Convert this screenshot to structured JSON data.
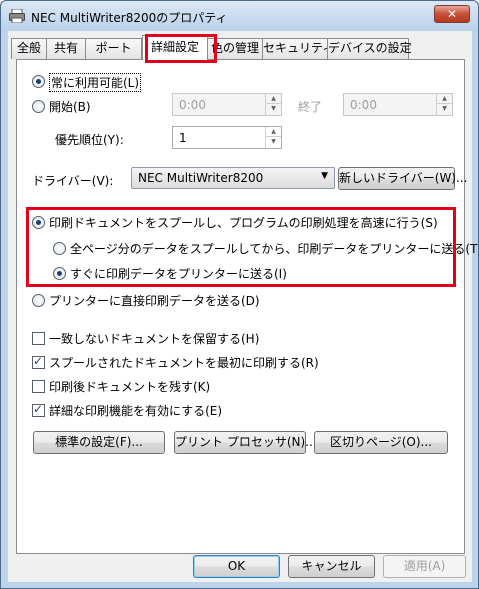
{
  "window": {
    "title": "NEC MultiWriter8200のプロパティ",
    "close_label": "✕"
  },
  "tabs": [
    {
      "label": "全般"
    },
    {
      "label": "共有"
    },
    {
      "label": "ポート"
    },
    {
      "label": "詳細設定"
    },
    {
      "label": "色の管理"
    },
    {
      "label": "セキュリティ"
    },
    {
      "label": "デバイスの設定"
    }
  ],
  "availability": {
    "always_label": "常に利用可能(L)",
    "from_label": "開始(B)",
    "start_time": "0:00",
    "until_label": "終了",
    "end_time": "0:00"
  },
  "priority": {
    "label": "優先順位(Y):",
    "value": "1"
  },
  "driver": {
    "label": "ドライバー(V):",
    "selected": "NEC MultiWriter8200",
    "new_driver_button": "新しいドライバー(W)..."
  },
  "spool": {
    "spool_label": "印刷ドキュメントをスプールし、プログラムの印刷処理を高速に行う(S)",
    "after_last_page_label": "全ページ分のデータをスプールしてから、印刷データをプリンターに送る(T)",
    "immediately_label": "すぐに印刷データをプリンターに送る(I)",
    "direct_label": "プリンターに直接印刷データを送る(D)"
  },
  "options": {
    "hold_mismatched": "一致しないドキュメントを保留する(H)",
    "print_spooled_first": "スプールされたドキュメントを最初に印刷する(R)",
    "keep_printed": "印刷後ドキュメントを残す(K)",
    "enable_advanced": "詳細な印刷機能を有効にする(E)"
  },
  "action_buttons": {
    "defaults": "標準の設定(F)...",
    "processor": "プリント プロセッサ(N)...",
    "separator_page": "区切りページ(O)..."
  },
  "footer": {
    "ok": "OK",
    "cancel": "キャンセル",
    "apply": "適用(A)"
  },
  "colors": {
    "highlight_box": "#e4001b",
    "window_frame": "#bcd3ea",
    "dialog_bg": "#f0f0f0"
  }
}
